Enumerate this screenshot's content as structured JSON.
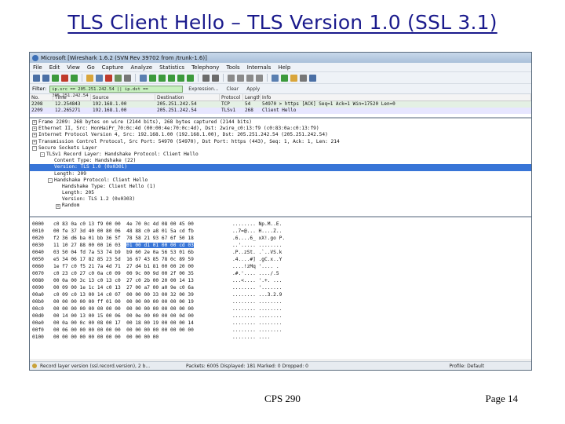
{
  "slide": {
    "title": "TLS Client Hello – TLS Version 1.0 (SSL 3.1)",
    "footer_center": "CPS 290",
    "footer_right": "Page 14"
  },
  "window": {
    "title": "Microsoft  [Wireshark 1.6.2  (SVN Rev 39702 from /trunk-1.6)]"
  },
  "menu": [
    "File",
    "Edit",
    "View",
    "Go",
    "Capture",
    "Analyze",
    "Statistics",
    "Telephony",
    "Tools",
    "Internals",
    "Help"
  ],
  "filter": {
    "label": "Filter:",
    "value": "ip.src == 205.251.242.54 || ip.dst == 205.251.242.54",
    "expression": "Expression...",
    "clear": "Clear",
    "apply": "Apply"
  },
  "packet_list": {
    "columns": [
      "No.",
      "Time",
      "Source",
      "Destination",
      "Protocol",
      "Length",
      "Info"
    ],
    "rows": [
      [
        "2208",
        "12.254843",
        "192.168.1.00",
        "205.251.242.54",
        "TCP",
        "54",
        "54970 > https [ACK] Seq=1 Ack=1 Win=17520 Len=0"
      ],
      [
        "2209",
        "12.265271",
        "192.168.1.00",
        "205.251.242.54",
        "TLSv1",
        "268",
        "Client Hello"
      ]
    ]
  },
  "details": [
    {
      "exp": "+",
      "indent": 0,
      "text": "Frame 2209: 268 bytes on wire (2144 bits), 268 bytes captured (2144 bits)"
    },
    {
      "exp": "+",
      "indent": 0,
      "text": "Ethernet II, Src: HonHaiPr_70:0c:4d (00:00:4e:70:0c:4d), Dst: 2wire_c0:13:f9 (c0:83:0a:c0:13:f9)"
    },
    {
      "exp": "+",
      "indent": 0,
      "text": "Internet Protocol Version 4, Src: 192.168.1.00 (192.168.1.00), Dst: 205.251.242.54 (205.251.242.54)"
    },
    {
      "exp": "+",
      "indent": 0,
      "text": "Transmission Control Protocol, Src Port: 54970 (54970), Dst Port: https (443), Seq: 1, Ack: 1, Len: 214"
    },
    {
      "exp": "-",
      "indent": 0,
      "text": "Secure Sockets Layer"
    },
    {
      "exp": "-",
      "indent": 1,
      "text": "TLSv1 Record Layer: Handshake Protocol: Client Hello"
    },
    {
      "exp": "",
      "indent": 2,
      "text": "Content Type: Handshake (22)"
    },
    {
      "exp": "",
      "indent": 2,
      "text": "Version: TLS 1.0 (0x0301)",
      "selected": true
    },
    {
      "exp": "",
      "indent": 2,
      "text": "Length: 209"
    },
    {
      "exp": "-",
      "indent": 2,
      "text": "Handshake Protocol: Client Hello"
    },
    {
      "exp": "",
      "indent": 3,
      "text": "Handshake Type: Client Hello (1)"
    },
    {
      "exp": "",
      "indent": 3,
      "text": "Length: 205"
    },
    {
      "exp": "",
      "indent": 3,
      "text": "Version: TLS 1.2 (0x0303)"
    },
    {
      "exp": "+",
      "indent": 3,
      "text": "Random"
    }
  ],
  "hex": {
    "offsets": [
      "0000",
      "0010",
      "0020",
      "0030",
      "0040",
      "0050",
      "0060",
      "0070",
      "0080",
      "0090",
      "00a0",
      "00b0",
      "00c0",
      "00d0",
      "00e0",
      "00f0",
      "0100"
    ],
    "bytes": [
      [
        "c0 83 0a c0 13 f9 00 00",
        "4e 70 0c 4d 08 00 45 00"
      ],
      [
        "00 fe 37 3d 40 00 80 06",
        "48 88 c0 a8 01 5a cd fb"
      ],
      [
        "f2 36 d6 ba 01 bb 36 5f",
        "78 58 21 93 67 6f 50 18"
      ],
      [
        "11 10 27 88 00 00 16 03",
        "01 00 d1 01 00 00 cd 03"
      ],
      [
        "03 50 04 fd 7a 53 74 b9",
        "b9 60 2e 0a 56 53 01 6b"
      ],
      [
        "e5 34 06 17 82 85 23 5d",
        "16 67 43 85 78 0c 89 59"
      ],
      [
        "1e f7 c0 f5 21 7a 4d 71",
        "27 d4 b1 81 00 00 20 00"
      ],
      [
        "c0 23 c0 27 c0 0a c0 09",
        "00 9c 00 9d 00 2f 00 35"
      ],
      [
        "00 0a 00 3c 13 c0 13 c0",
        "27 c0 2b 00 20 00 14 13"
      ],
      [
        "00 09 00 1e 1c 14 c0 13",
        "27 00 a7 00 a0 9e c0 6a"
      ],
      [
        "c0 09 c0 13 00 14 c0 07",
        "00 00 00 33 00 32 00 39"
      ],
      [
        "00 00 00 00 00 ff 01 00",
        "00 00 00 00 00 00 00 19"
      ],
      [
        "00 00 00 00 00 00 00 00",
        "00 00 00 00 00 00 00 00"
      ],
      [
        "00 14 00 13 00 15 00 06",
        "00 0e 00 00 00 00 0d 00"
      ],
      [
        "00 0a 00 0c 00 08 00 17",
        "00 18 00 19 00 00 00 14"
      ],
      [
        "00 06 00 00 00 00 00 00",
        "00 00 00 00 00 00 00 00"
      ],
      [
        "00 00 00 00 00 00 00 00",
        "00 00 00 00"
      ]
    ],
    "ascii": [
      "........ Np.M..E.",
      "..7=@... H....Z..",
      ".6....6_ xX!.go P.",
      "..'..... ........",
      ".P..zSt. .`..VS.k",
      ".4....#] .gC.x..Y",
      "....!zMq '.... .",
      ".#.'.... ..../.5",
      "...<.... '.+. ...",
      "........ '.......",
      "........ ...3.2.9",
      "........ ........",
      "........ ........",
      "........ ........",
      "........ ........",
      "........ ........",
      "........ ...."
    ]
  },
  "status": {
    "left": "Record layer version (ssl.record.version), 2 b...",
    "center": "Packets: 6005 Displayed: 181 Marked: 0 Dropped: 0",
    "right": "Profile: Default"
  },
  "colors": {
    "title": "#1a1a8c",
    "selection": "#3875d7",
    "filter_ok": "#c8f0c0"
  }
}
